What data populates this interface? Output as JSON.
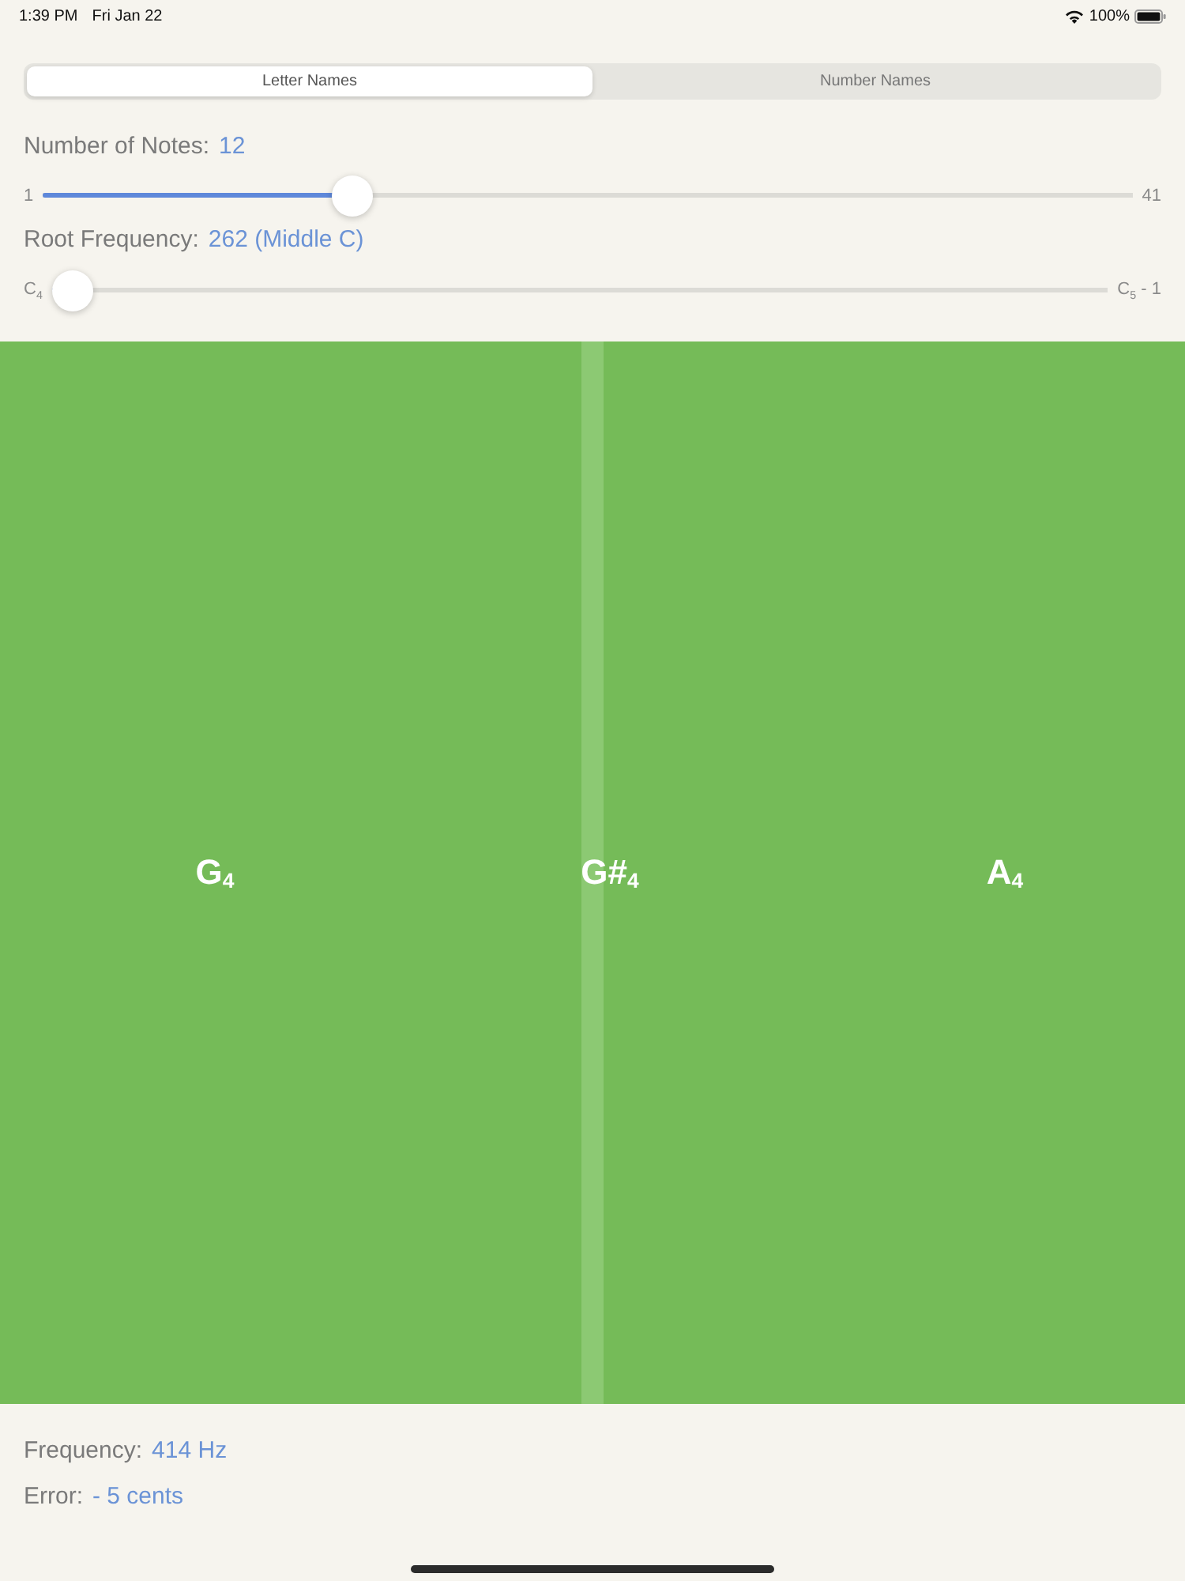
{
  "status_bar": {
    "time": "1:39 PM",
    "date": "Fri Jan 22",
    "battery": "100%"
  },
  "segments": [
    {
      "label": "Letter Names",
      "selected": true
    },
    {
      "label": "Number Names",
      "selected": false
    }
  ],
  "settings": [
    {
      "label": "Number of Notes:",
      "value": "12",
      "min_label": "1",
      "max_label": "41",
      "level": 0.275
    },
    {
      "label": "Root Frequency:",
      "value": "262 (Middle C)",
      "min_label": "C$_{4}$",
      "max_label": "C$_{5}$ - 1",
      "level": 0
    }
  ],
  "keyboard": {
    "notes": [
      {
        "label": "G$_{4}$"
      },
      {
        "label": "G#$_{4}$"
      },
      {
        "label": "A$_{4}$"
      }
    ]
  },
  "readouts": [
    {
      "label": "Frequency:",
      "value": "414 Hz"
    },
    {
      "label": "Error:",
      "value": "- 5 cents"
    }
  ]
}
